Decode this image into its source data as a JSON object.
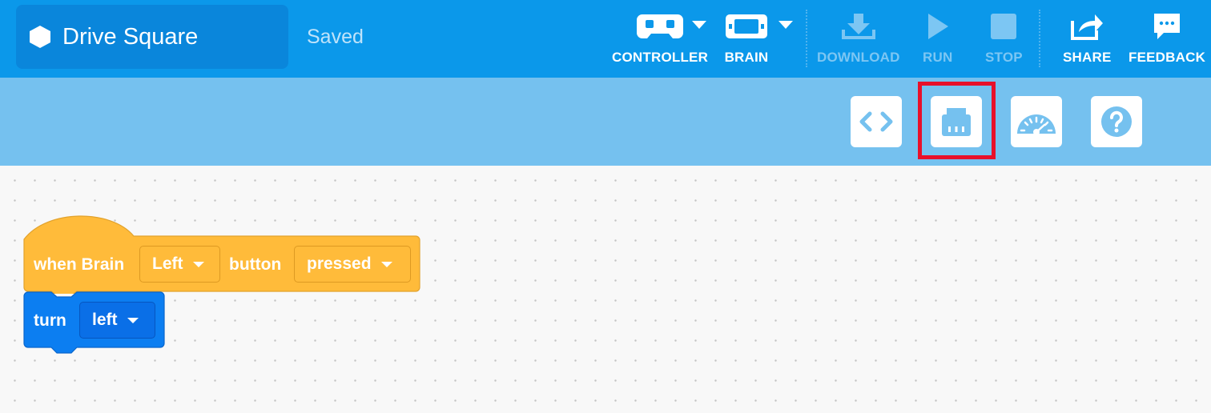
{
  "project": {
    "title": "Drive Square",
    "status": "Saved"
  },
  "toolbar": {
    "controller_label": "CONTROLLER",
    "brain_label": "BRAIN",
    "download_label": "DOWNLOAD",
    "run_label": "RUN",
    "stop_label": "STOP",
    "share_label": "SHARE",
    "feedback_label": "FEEDBACK"
  },
  "subtoolbar": {
    "buttons": [
      "code-view-icon",
      "devices-icon",
      "dashboard-icon",
      "help-icon"
    ],
    "highlighted": "devices-icon",
    "highlight_color": "#e8102a"
  },
  "blocks": {
    "event": {
      "text_prefix": "when Brain",
      "button_value": "Left",
      "text_middle": "button",
      "action_value": "pressed",
      "color": "#ffbb3a"
    },
    "turn": {
      "text": "turn",
      "direction_value": "left",
      "color": "#0c7ef1"
    }
  },
  "colors": {
    "topbar": "#0b98ea",
    "subbar": "#75c1ef",
    "canvas": "#f8f8f8"
  }
}
